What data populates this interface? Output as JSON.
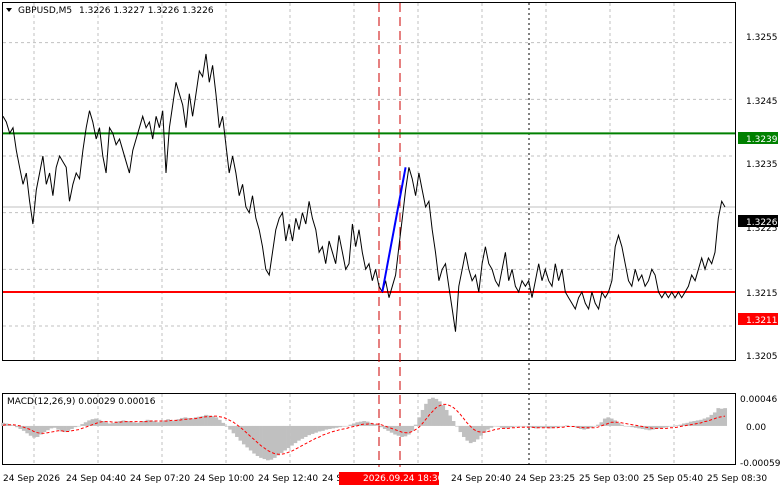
{
  "header": {
    "symbol": "GBPUSD,M5",
    "ohlc": "1.3226 1.3227 1.3226 1.3226"
  },
  "colors": {
    "background": "#ffffff",
    "price_line": "#000000",
    "highlight_line": "#0000ff",
    "resistance": "#008000",
    "support": "#ff0000",
    "grid": "#c0c0c0",
    "macd_hist": "#c0c0c0",
    "macd_signal": "#ff0000",
    "current_label_bg": "#000000",
    "vline_red": "#cc0000"
  },
  "price_axis": {
    "ticks": [
      "1.3255",
      "1.3245",
      "1.3235",
      "1.3225",
      "1.3215",
      "1.3205"
    ]
  },
  "levels": {
    "resistance": {
      "value": 1.3239,
      "label": "1.3239"
    },
    "support": {
      "value": 1.3211,
      "label": "1.3211"
    },
    "current": {
      "value": 1.3226,
      "label": "1.3226"
    }
  },
  "time_axis": {
    "labels": [
      "24 Sep 2026",
      "24 Sep 04:40",
      "24 Sep 07:20",
      "24 Sep 10:00",
      "24 Sep 12:40",
      "24 Sep 15:20",
      "24 Sep 20:40",
      "24 Sep 23:25",
      "25 Sep 03:00",
      "25 Sep 05:40",
      "25 Sep 08:30"
    ],
    "highlight_label": "2026.09.24 18:30"
  },
  "macd": {
    "title": "MACD(12,26,9) 0.00029 0.00016",
    "ticks": [
      "0.00046",
      "0.00",
      "-0.00059"
    ]
  },
  "chart_data": {
    "type": "line",
    "ylim": [
      1.3199,
      1.3262
    ],
    "series": [
      {
        "values": [
          1.3242,
          1.3241,
          1.3239,
          1.324,
          1.3236,
          1.3233,
          1.323,
          1.3232,
          1.3227,
          1.3223,
          1.3229,
          1.3232,
          1.3235,
          1.323,
          1.3232,
          1.3228,
          1.3233,
          1.3235,
          1.3234,
          1.3233,
          1.3227,
          1.323,
          1.3232,
          1.3231,
          1.3236,
          1.324,
          1.3243,
          1.3241,
          1.3238,
          1.324,
          1.3235,
          1.3232,
          1.324,
          1.3239,
          1.3237,
          1.3238,
          1.3236,
          1.3234,
          1.3232,
          1.3236,
          1.3238,
          1.324,
          1.3242,
          1.324,
          1.3241,
          1.3238,
          1.3242,
          1.324,
          1.3243,
          1.3232,
          1.324,
          1.3244,
          1.3248,
          1.3246,
          1.3244,
          1.324,
          1.3246,
          1.3242,
          1.3246,
          1.325,
          1.3249,
          1.3253,
          1.3248,
          1.3251,
          1.3246,
          1.324,
          1.3242,
          1.3237,
          1.3232,
          1.3235,
          1.3232,
          1.3228,
          1.323,
          1.3226,
          1.3225,
          1.3228,
          1.3224,
          1.3222,
          1.3219,
          1.3215,
          1.3214,
          1.3218,
          1.3222,
          1.3224,
          1.3225,
          1.322,
          1.3223,
          1.322,
          1.3224,
          1.3222,
          1.3225,
          1.3223,
          1.3227,
          1.3224,
          1.3222,
          1.3218,
          1.3219,
          1.3216,
          1.322,
          1.3218,
          1.3216,
          1.3221,
          1.3218,
          1.3215,
          1.3216,
          1.3223,
          1.3219,
          1.3222,
          1.3218,
          1.3215,
          1.3216,
          1.3213,
          1.3215,
          1.3212,
          1.3211,
          1.3213,
          1.321,
          1.3212,
          1.3214,
          1.3219,
          1.3224,
          1.3229,
          1.3233,
          1.3231,
          1.3228,
          1.3232,
          1.3229,
          1.3226,
          1.3227,
          1.3222,
          1.3218,
          1.3213,
          1.3215,
          1.3216,
          1.3212,
          1.3208,
          1.3204,
          1.3212,
          1.3215,
          1.3218,
          1.3215,
          1.3213,
          1.3214,
          1.3211,
          1.3216,
          1.3219,
          1.3216,
          1.3215,
          1.3213,
          1.3212,
          1.3215,
          1.3218,
          1.3213,
          1.3215,
          1.3212,
          1.3211,
          1.3213,
          1.3212,
          1.3213,
          1.321,
          1.3213,
          1.3216,
          1.3213,
          1.3215,
          1.3213,
          1.3212,
          1.3216,
          1.3213,
          1.3215,
          1.3211,
          1.321,
          1.3209,
          1.3208,
          1.321,
          1.3211,
          1.3209,
          1.3208,
          1.3211,
          1.3209,
          1.3208,
          1.3211,
          1.321,
          1.3211,
          1.3213,
          1.3219,
          1.3221,
          1.3219,
          1.3216,
          1.3213,
          1.3212,
          1.3215,
          1.3213,
          1.3214,
          1.3212,
          1.3213,
          1.3215,
          1.3214,
          1.3211,
          1.321,
          1.3211,
          1.321,
          1.3211,
          1.321,
          1.3211,
          1.321,
          1.3211,
          1.3212,
          1.3214,
          1.3213,
          1.3215,
          1.3217,
          1.3215,
          1.3217,
          1.3216,
          1.3218,
          1.3224,
          1.3227,
          1.3226
        ]
      },
      {
        "name": "highlight",
        "x_index": [
          114,
          121
        ],
        "values": [
          1.3211,
          1.3233
        ]
      }
    ],
    "macd": {
      "ylim": [
        -0.00062,
        0.00052
      ],
      "hist": [
        5e-05,
        4e-05,
        2e-05,
        1e-05,
        -2e-05,
        -5e-05,
        -8e-05,
        -0.00012,
        -0.00016,
        -0.00019,
        -0.00018,
        -0.00014,
        -0.0001,
        -7e-05,
        -4e-05,
        -3e-05,
        -6e-05,
        -9e-05,
        -0.0001,
        -8e-05,
        -5e-05,
        -2e-05,
        0.0,
        3e-05,
        6e-05,
        9e-05,
        0.00011,
        0.00012,
        0.0001,
        8e-05,
        6e-05,
        4e-05,
        5e-05,
        7e-05,
        8e-05,
        9e-05,
        8e-05,
        7e-05,
        6e-05,
        5e-05,
        6e-05,
        8e-05,
        0.0001,
        9e-05,
        8e-05,
        6e-05,
        7e-05,
        9e-05,
        0.00011,
        8e-05,
        9e-05,
        0.00011,
        0.00013,
        0.00014,
        0.00013,
        0.00012,
        0.00014,
        0.00015,
        0.00016,
        0.00018,
        0.00017,
        0.00016,
        0.00014,
        0.0001,
        5e-05,
        0.0,
        -6e-05,
        -0.00012,
        -0.00018,
        -0.00024,
        -0.0003,
        -0.00035,
        -0.0004,
        -0.00045,
        -0.00049,
        -0.00052,
        -0.00054,
        -0.00056,
        -0.00055,
        -0.00052,
        -0.00048,
        -0.00044,
        -0.0004,
        -0.00036,
        -0.00032,
        -0.00028,
        -0.00024,
        -0.00021,
        -0.00018,
        -0.00015,
        -0.00013,
        -0.00011,
        -9e-05,
        -8e-05,
        -6e-05,
        -5e-05,
        -4e-05,
        -3e-05,
        -2e-05,
        -1e-05,
        0.0,
        2e-05,
        4e-05,
        6e-05,
        7e-05,
        8e-05,
        7e-05,
        5e-05,
        3e-05,
        1e-05,
        -2e-05,
        -5e-05,
        -8e-05,
        -0.00011,
        -0.00014,
        -0.00016,
        -0.00018,
        -0.00017,
        -0.00014,
        -8e-05,
        2e-05,
        0.00014,
        0.00026,
        0.00036,
        0.00044,
        0.00046,
        0.00044,
        0.0004,
        0.00034,
        0.00026,
        0.00017,
        8e-05,
        -1e-05,
        -0.0001,
        -0.00018,
        -0.00024,
        -0.00028,
        -0.00026,
        -0.00022,
        -0.00016,
        -0.00011,
        -6e-05,
        -3e-05,
        0.0,
        -1e-05,
        -3e-05,
        -4e-05,
        -3e-05,
        -2e-05,
        -1e-05,
        0.0,
        0.0,
        -1e-05,
        -2e-05,
        -3e-05,
        -4e-05,
        -3e-05,
        -2e-05,
        -3e-05,
        -4e-05,
        -3e-05,
        -2e-05,
        -1e-05,
        0.0,
        1e-05,
        0.0,
        -1e-05,
        -3e-05,
        -5e-05,
        -6e-05,
        -5e-05,
        -3e-05,
        -1e-05,
        2e-05,
        6e-05,
        0.00012,
        0.00014,
        0.00012,
        9e-05,
        5e-05,
        2e-05,
        0.0,
        -1e-05,
        -2e-05,
        -3e-05,
        -4e-05,
        -5e-05,
        -6e-05,
        -7e-05,
        -6e-05,
        -5e-05,
        -4e-05,
        -3e-05,
        -2e-05,
        -1e-05,
        0.0,
        1e-05,
        2e-05,
        4e-05,
        5e-05,
        7e-05,
        8e-05,
        9e-05,
        0.0001,
        0.00012,
        0.00014,
        0.00018,
        0.00022,
        0.00029,
        0.00028,
        0.00029
      ],
      "signal": [
        1e-05,
        2e-05,
        2e-05,
        2e-05,
        1e-05,
        0.0,
        -2e-05,
        -4e-05,
        -6e-05,
        -9e-05,
        -0.00011,
        -0.00012,
        -0.00012,
        -0.00011,
        -0.0001,
        -9e-05,
        -8e-05,
        -8e-05,
        -9e-05,
        -9e-05,
        -8e-05,
        -7e-05,
        -6e-05,
        -4e-05,
        -2e-05,
        0.0,
        2e-05,
        4e-05,
        6e-05,
        7e-05,
        7e-05,
        7e-05,
        6e-05,
        6e-05,
        6e-05,
        7e-05,
        7e-05,
        7e-05,
        7e-05,
        7e-05,
        7e-05,
        7e-05,
        7e-05,
        8e-05,
        8e-05,
        8e-05,
        8e-05,
        8e-05,
        8e-05,
        9e-05,
        9e-05,
        9e-05,
        0.0001,
        0.00011,
        0.00011,
        0.00012,
        0.00012,
        0.00013,
        0.00014,
        0.00015,
        0.00015,
        0.00016,
        0.00016,
        0.00015,
        0.00014,
        0.00012,
        9e-05,
        6e-05,
        2e-05,
        -2e-05,
        -7e-05,
        -0.00012,
        -0.00017,
        -0.00022,
        -0.00027,
        -0.00032,
        -0.00036,
        -0.0004,
        -0.00043,
        -0.00045,
        -0.00046,
        -0.00046,
        -0.00045,
        -0.00043,
        -0.00041,
        -0.00038,
        -0.00035,
        -0.00032,
        -0.00029,
        -0.00026,
        -0.00023,
        -0.0002,
        -0.00018,
        -0.00015,
        -0.00013,
        -0.00011,
        -9e-05,
        -8e-05,
        -6e-05,
        -5e-05,
        -4e-05,
        -2e-05,
        -1e-05,
        0.0,
        2e-05,
        3e-05,
        3e-05,
        4e-05,
        3e-05,
        3e-05,
        2e-05,
        0.0,
        -2e-05,
        -4e-05,
        -6e-05,
        -8e-05,
        -0.0001,
        -0.00011,
        -0.00011,
        -9e-05,
        -6e-05,
        -2e-05,
        4e-05,
        0.00011,
        0.00018,
        0.00024,
        0.0003,
        0.00033,
        0.00035,
        0.00035,
        0.00033,
        0.0003,
        0.00025,
        0.00019,
        0.00012,
        5e-05,
        -1e-05,
        -6e-05,
        -9e-05,
        -0.0001,
        -0.0001,
        -9e-05,
        -8e-05,
        -6e-05,
        -5e-05,
        -4e-05,
        -4e-05,
        -4e-05,
        -3e-05,
        -3e-05,
        -2e-05,
        -2e-05,
        -2e-05,
        -2e-05,
        -2e-05,
        -3e-05,
        -3e-05,
        -3e-05,
        -3e-05,
        -3e-05,
        -3e-05,
        -3e-05,
        -2e-05,
        -2e-05,
        -1e-05,
        -1e-05,
        -1e-05,
        -2e-05,
        -2e-05,
        -3e-05,
        -3e-05,
        -3e-05,
        -3e-05,
        -2e-05,
        0.0,
        2e-05,
        4e-05,
        6e-05,
        6e-05,
        6e-05,
        5e-05,
        4e-05,
        3e-05,
        2e-05,
        1e-05,
        0.0,
        -1e-05,
        -2e-05,
        -3e-05,
        -4e-05,
        -4e-05,
        -4e-05,
        -4e-05,
        -4e-05,
        -3e-05,
        -3e-05,
        -2e-05,
        -1e-05,
        0.0,
        1e-05,
        2e-05,
        3e-05,
        4e-05,
        5e-05,
        7e-05,
        8e-05,
        0.0001,
        0.00012,
        0.00014,
        0.00015,
        0.00016
      ]
    }
  }
}
